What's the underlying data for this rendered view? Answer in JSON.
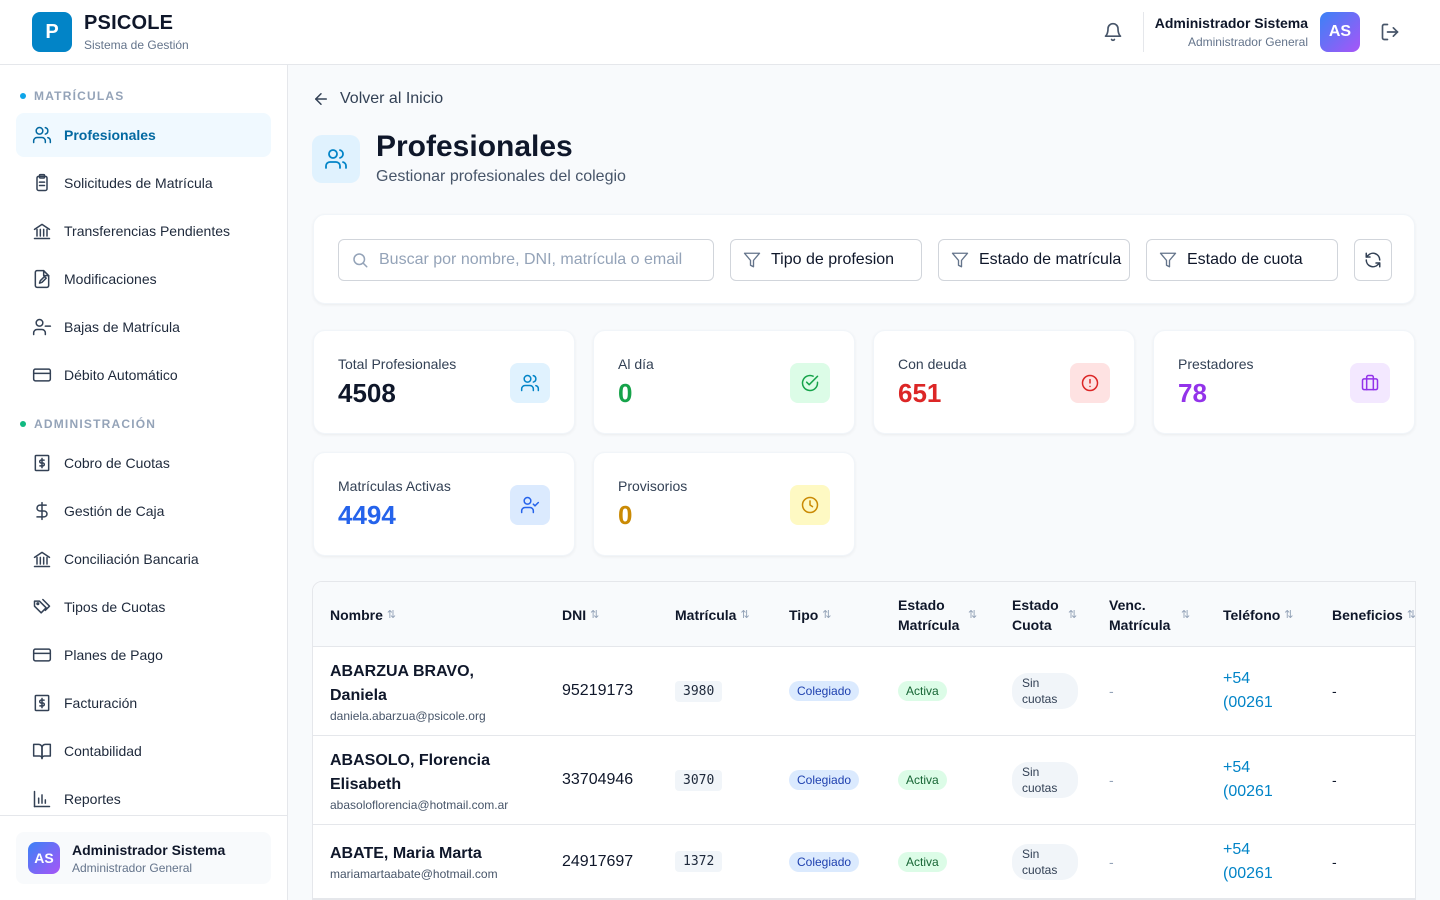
{
  "header": {
    "logo_letter": "P",
    "brand": "PSICOLE",
    "brand_sub": "Sistema de Gestión",
    "user_name": "Administrador Sistema",
    "user_role": "Administrador General",
    "avatar_initials": "AS"
  },
  "sidebar": {
    "section1": "MATRÍCULAS",
    "section1_color": "#0ea5e9",
    "section2": "ADMINISTRACIÓN",
    "section2_color": "#10b981",
    "items": [
      {
        "label": "Profesionales",
        "icon": "users-icon",
        "active": true
      },
      {
        "label": "Solicitudes de Matrícula",
        "icon": "clipboard-icon"
      },
      {
        "label": "Transferencias Pendientes",
        "icon": "bank-icon"
      },
      {
        "label": "Modificaciones",
        "icon": "file-edit-icon"
      },
      {
        "label": "Bajas de Matrícula",
        "icon": "user-minus-icon"
      },
      {
        "label": "Débito Automático",
        "icon": "credit-card-icon"
      },
      {
        "label": "Cobro de Cuotas",
        "icon": "receipt-dollar-icon"
      },
      {
        "label": "Gestión de Caja",
        "icon": "dollar-icon"
      },
      {
        "label": "Conciliación Bancaria",
        "icon": "bank-icon"
      },
      {
        "label": "Tipos de Cuotas",
        "icon": "tags-icon"
      },
      {
        "label": "Planes de Pago",
        "icon": "credit-card-icon"
      },
      {
        "label": "Facturación",
        "icon": "receipt-dollar-icon"
      },
      {
        "label": "Contabilidad",
        "icon": "book-icon"
      },
      {
        "label": "Reportes",
        "icon": "bar-chart-icon"
      }
    ],
    "footer_user_name": "Administrador Sistema",
    "footer_user_role": "Administrador General",
    "footer_initials": "AS"
  },
  "main": {
    "back_label": "Volver al Inicio",
    "title": "Profesionales",
    "subtitle": "Gestionar profesionales del colegio",
    "search_placeholder": "Buscar por nombre, DNI, matrícula o email",
    "filters": [
      "Tipo de profesion",
      "Estado de matrícula",
      "Estado de cuota"
    ],
    "stats": [
      {
        "label": "Total Profesionales",
        "value": "4508",
        "color": "#0f172a",
        "icon": "users-icon",
        "icon_bg": "#e0f2fe",
        "icon_color": "#0284c7"
      },
      {
        "label": "Al día",
        "value": "0",
        "color": "#16a34a",
        "icon": "check-circle-icon",
        "icon_bg": "#dcfce7",
        "icon_color": "#16a34a"
      },
      {
        "label": "Con deuda",
        "value": "651",
        "color": "#dc2626",
        "icon": "alert-circle-icon",
        "icon_bg": "#fee2e2",
        "icon_color": "#dc2626"
      },
      {
        "label": "Prestadores",
        "value": "78",
        "color": "#9333ea",
        "icon": "briefcase-icon",
        "icon_bg": "#f3e8ff",
        "icon_color": "#9333ea"
      },
      {
        "label": "Matrículas Activas",
        "value": "4494",
        "color": "#2563eb",
        "icon": "user-check-icon",
        "icon_bg": "#dbeafe",
        "icon_color": "#2563eb"
      },
      {
        "label": "Provisorios",
        "value": "0",
        "color": "#ca8a04",
        "icon": "clock-icon",
        "icon_bg": "#fef9c3",
        "icon_color": "#ca8a04"
      }
    ],
    "table": {
      "columns": [
        "Nombre",
        "DNI",
        "Matrícula",
        "Tipo",
        "Estado Matrícula",
        "Estado Cuota",
        "Venc. Matrícula",
        "Teléfono",
        "Beneficios"
      ],
      "rows": [
        {
          "name": "ABARZUA BRAVO, Daniela",
          "email": "daniela.abarzua@psicole.org",
          "dni": "95219173",
          "matricula": "3980",
          "tipo": "Colegiado",
          "estado_matricula": "Activa",
          "estado_cuota": "Sin cuotas",
          "venc": "-",
          "telefono": "+54 (00261",
          "beneficios": "-"
        },
        {
          "name": "ABASOLO, Florencia Elisabeth",
          "email": "abasoloflorencia@hotmail.com.ar",
          "dni": "33704946",
          "matricula": "3070",
          "tipo": "Colegiado",
          "estado_matricula": "Activa",
          "estado_cuota": "Sin cuotas",
          "venc": "-",
          "telefono": "+54 (00261",
          "beneficios": "-"
        },
        {
          "name": "ABATE, Maria Marta",
          "email": "mariamartaabate@hotmail.com",
          "dni": "24917697",
          "matricula": "1372",
          "tipo": "Colegiado",
          "estado_matricula": "Activa",
          "estado_cuota": "Sin cuotas",
          "venc": "-",
          "telefono": "+54 (00261",
          "beneficios": "-"
        }
      ]
    }
  }
}
